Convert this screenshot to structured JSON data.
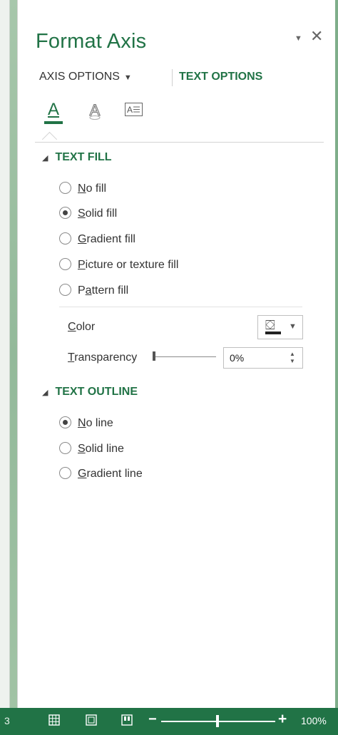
{
  "pane": {
    "title": "Format Axis",
    "menu_glyph": "▼",
    "close_glyph": "✕",
    "tabs": {
      "axis_options": "AXIS OPTIONS",
      "caret": "▼",
      "text_options": "TEXT OPTIONS"
    },
    "icon_tabs": [
      {
        "name": "text-fill-outline-icon",
        "glyph": "A"
      },
      {
        "name": "text-effects-icon",
        "glyph": "A"
      },
      {
        "name": "textbox-icon",
        "glyph": "A≡"
      }
    ]
  },
  "text_fill": {
    "header": "TEXT FILL",
    "options": [
      {
        "first": "N",
        "rest": "o fill",
        "checked": false
      },
      {
        "first": "S",
        "rest": "olid fill",
        "checked": true
      },
      {
        "first": "G",
        "rest": "radient fill",
        "checked": false
      },
      {
        "first": "P",
        "rest": "icture or texture fill",
        "checked": false
      },
      {
        "pre": "P",
        "first": "a",
        "rest": "ttern fill",
        "checked": false
      }
    ],
    "color_label_first": "C",
    "color_label_rest": "olor",
    "transparency_label_first": "T",
    "transparency_label_rest": "ransparency",
    "transparency_value": "0%",
    "transparency_level": 0
  },
  "text_outline": {
    "header": "TEXT OUTLINE",
    "options": [
      {
        "first": "N",
        "rest": "o line",
        "checked": true
      },
      {
        "first": "S",
        "rest": "olid line",
        "checked": false
      },
      {
        "first": "G",
        "rest": "radient line",
        "checked": false
      }
    ]
  },
  "status_bar": {
    "left_fragment": "3",
    "zoom_minus": "−",
    "zoom_plus": "+",
    "zoom_value": "100%"
  },
  "colors": {
    "accent": "#217346",
    "pane_bg": "#ffffff",
    "text": "#333333"
  }
}
